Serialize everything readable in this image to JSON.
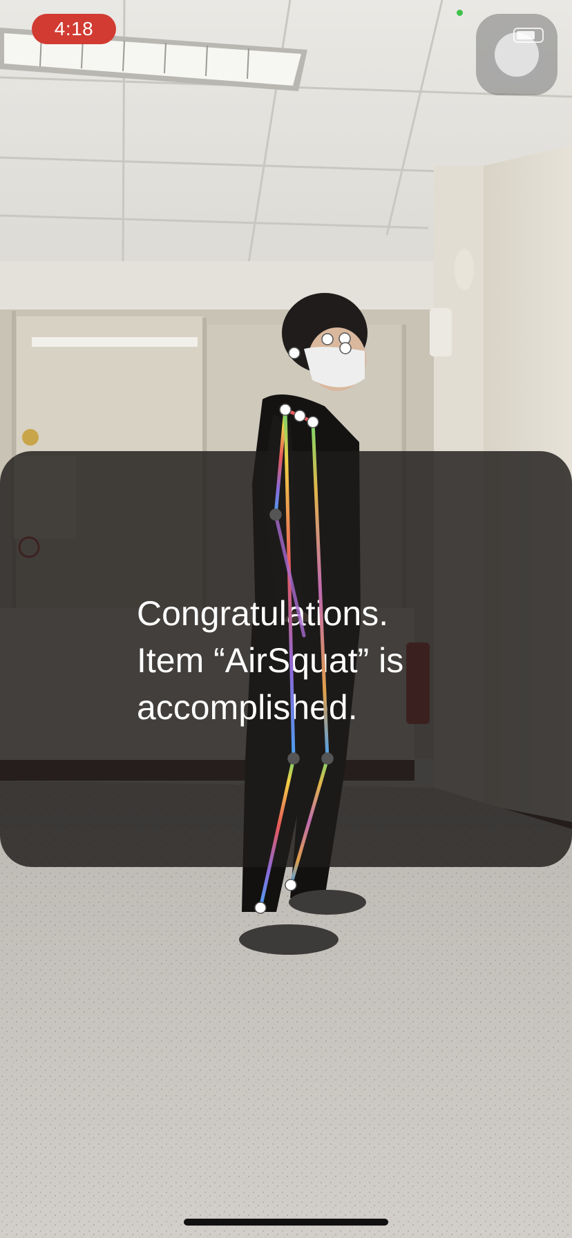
{
  "status_bar": {
    "time": "4:18",
    "recording_color": "#d13b32",
    "camera_indicator_color": "#3ec24a"
  },
  "assistive_touch": {
    "icon": "assistive-touch-icon"
  },
  "result": {
    "message": "Congratulations.\n Item “AirSquat” is\naccomplished."
  },
  "pose": {
    "left_line_colors": [
      "#e44c4c",
      "#f5d23c",
      "#5ac85a",
      "#4aa0e8"
    ],
    "joint_color": "#ffffff"
  }
}
